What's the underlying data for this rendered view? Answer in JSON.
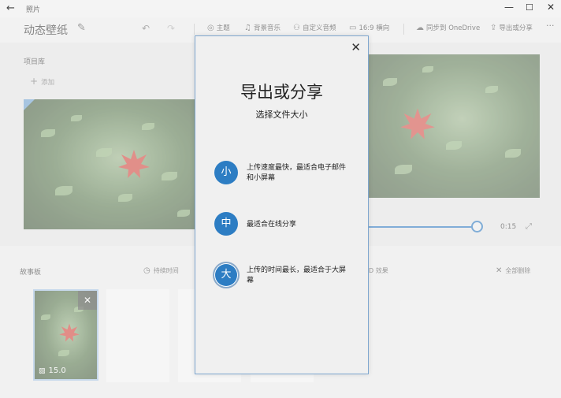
{
  "titlebar": {
    "app_title": "照片",
    "back_icon": "back-arrow-icon",
    "minimize": "—",
    "maximize": "☐",
    "close": "✕"
  },
  "toolbar": {
    "project_name": "动态壁纸",
    "theme": "主题",
    "music": "背景音乐",
    "custom_audio": "自定义音频",
    "aspect": "16:9 横向",
    "sync": "同步到 OneDrive",
    "export": "导出或分享",
    "more": "···"
  },
  "library": {
    "title": "项目库",
    "add": "添加"
  },
  "preview": {
    "time": "0:15",
    "progress": 1.0
  },
  "storyboard": {
    "title": "故事板",
    "duration": "持续时间",
    "effects": "D 效果",
    "delete_all": "全部删除",
    "clip_duration": "15.0"
  },
  "dialog": {
    "title": "导出或分享",
    "subtitle": "选择文件大小",
    "options": [
      {
        "glyph": "小",
        "text": "上传速度最快，最适合电子邮件和小屏幕"
      },
      {
        "glyph": "中",
        "text": "最适合在线分享"
      },
      {
        "glyph": "大",
        "text": "上传的时间最长，最适合于大屏幕"
      }
    ]
  },
  "colors": {
    "accent": "#2d7dc3",
    "dialog_border": "#7ea6cf"
  }
}
